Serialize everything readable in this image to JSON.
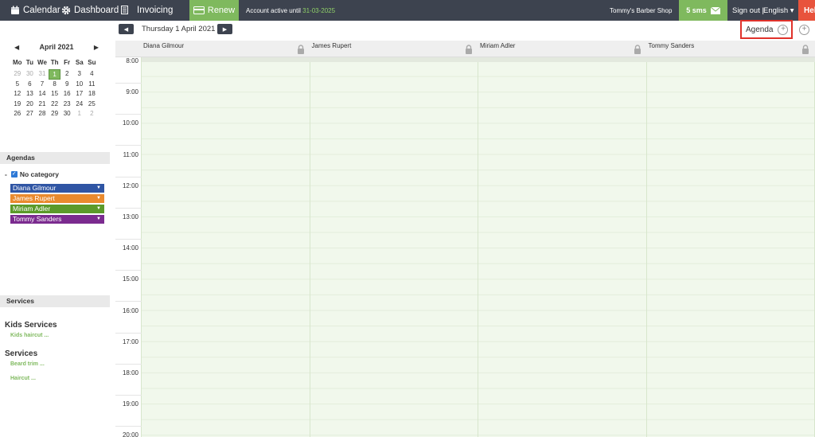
{
  "topbar": {
    "calendar": "Calendar",
    "dashboard": "Dashboard",
    "invoicing": "Invoicing",
    "renew": "Renew",
    "account_prefix": "Account active until ",
    "account_date": "31-03-2025",
    "shop": "Tommy's Barber Shop",
    "sms": "5 sms",
    "signout": "Sign out |",
    "language": "English ▾",
    "help": "Help"
  },
  "datebar": {
    "date": "Thursday 1 April 2021",
    "agenda_label": "Agenda"
  },
  "mini_calendar": {
    "month": "April 2021",
    "weekdays": [
      "Mo",
      "Tu",
      "We",
      "Th",
      "Fr",
      "Sa",
      "Su"
    ],
    "weeks": [
      [
        "29",
        "30",
        "31",
        "1",
        "2",
        "3",
        "4"
      ],
      [
        "5",
        "6",
        "7",
        "8",
        "9",
        "10",
        "11"
      ],
      [
        "12",
        "13",
        "14",
        "15",
        "16",
        "17",
        "18"
      ],
      [
        "19",
        "20",
        "21",
        "22",
        "23",
        "24",
        "25"
      ],
      [
        "26",
        "27",
        "28",
        "29",
        "30",
        "1",
        "2"
      ]
    ]
  },
  "sidebar": {
    "agendas_title": "Agendas",
    "category": "No category",
    "agendas": [
      {
        "name": "Diana Gilmour",
        "color": "#2f55a4"
      },
      {
        "name": "James Rupert",
        "color": "#e98a2e"
      },
      {
        "name": "Miriam Adler",
        "color": "#5b9a2a"
      },
      {
        "name": "Tommy Sanders",
        "color": "#7b2b8f"
      }
    ],
    "services_title": "Services",
    "service_groups": [
      {
        "name": "Kids Services",
        "items": [
          "Kids haircut ..."
        ]
      },
      {
        "name": "Services",
        "items": [
          "Beard trim ...",
          "Haircut ..."
        ]
      }
    ]
  },
  "calendar": {
    "columns": [
      "Diana Gilmour",
      "James Rupert",
      "Miriam Adler",
      "Tommy Sanders"
    ],
    "hours": [
      "8:00",
      "9:00",
      "10:00",
      "11:00",
      "12:00",
      "13:00",
      "14:00",
      "15:00",
      "16:00",
      "17:00",
      "18:00",
      "19:00",
      "20:00"
    ]
  }
}
